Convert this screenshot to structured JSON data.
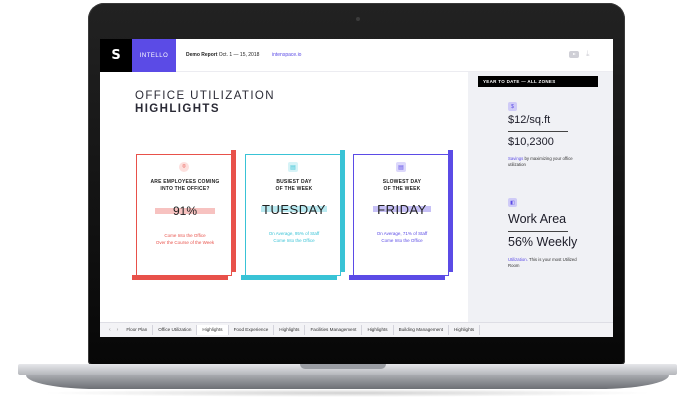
{
  "header": {
    "logo_text": "S",
    "brand": "INTELLO",
    "report_title": "Demo Report",
    "report_dates": "Oct. 1 — 15, 2018",
    "link": "intenspace.io",
    "video_icon": "video-icon",
    "download_icon": "download-icon"
  },
  "main": {
    "title_line1": "OFFICE UTILIZATION",
    "title_line2": "HIGHLIGHTS",
    "cards": [
      {
        "icon": "pin-icon",
        "question_line1": "ARE EMPLOYEES COMING",
        "question_line2": "INTO THE OFFICE?",
        "value": "91%",
        "note_line1": "Come Into the Office",
        "note_line2": "Over the Course of the Week",
        "color": "#e8514a"
      },
      {
        "icon": "calendar-icon",
        "question_line1": "BUSIEST DAY",
        "question_line2": "OF THE WEEK",
        "value": "TUESDAY",
        "note_line1": "On Average, 95% of Staff",
        "note_line2": "Come Into the Office",
        "color": "#39c3d6"
      },
      {
        "icon": "calendar-icon",
        "question_line1": "SLOWEST DAY",
        "question_line2": "OF THE WEEK",
        "value": "FRIDAY",
        "note_line1": "On Average, 71% of Staff",
        "note_line2": "Come Into the Office",
        "color": "#5b4be6"
      }
    ]
  },
  "sidebar": {
    "header": "YEAR TO DATE — ALL ZONES",
    "price_per_sqft": "$12/sq.ft",
    "savings": "$10,2300",
    "savings_note_highlight": "Savings",
    "savings_note_rest": " by maximizing your office utilization",
    "room": "Work Area",
    "weekly": "56% Weekly",
    "util_note_highlight": "Utilization.",
    "util_note_rest": " This is your most Utilized Room",
    "dollar_icon": "$",
    "room_icon": "◧"
  },
  "tabs": {
    "prev": "‹",
    "next": "›",
    "items": [
      "Floor Plan",
      "Office Utilization",
      "Highlights",
      "Food Experience",
      "Highlights",
      "Facilities Management",
      "Highlights",
      "Building Management",
      "Highlights"
    ],
    "active_index": 2
  }
}
